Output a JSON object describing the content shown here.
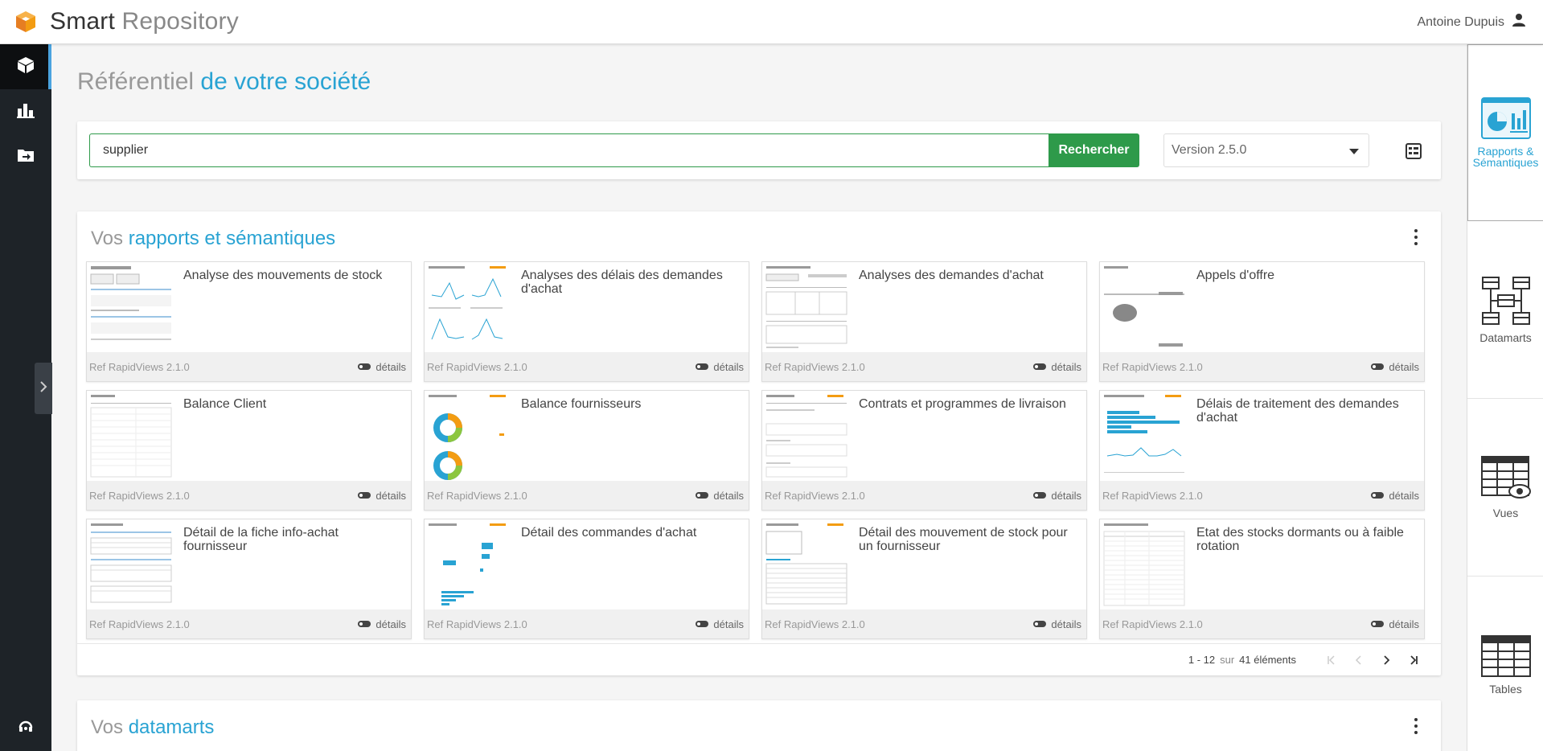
{
  "app": {
    "title_part1": "Smart",
    "title_part2": " Repository"
  },
  "user": {
    "name": "Antoine Dupuis"
  },
  "page": {
    "title_gray": "Référentiel ",
    "title_blue": "de votre société"
  },
  "search": {
    "value": "supplier",
    "button_label": "Rechercher",
    "version_selected": "Version 2.5.0"
  },
  "reports_section": {
    "title_gray": "Vos ",
    "title_blue": "rapports et sémantiques",
    "cards": [
      {
        "title": "Analyse des mouvements de stock",
        "ref": "Ref RapidViews 2.1.0",
        "details": "détails"
      },
      {
        "title": "Analyses des délais des demandes d'achat",
        "ref": "Ref RapidViews 2.1.0",
        "details": "détails"
      },
      {
        "title": "Analyses des demandes d'achat",
        "ref": "Ref RapidViews 2.1.0",
        "details": "détails"
      },
      {
        "title": "Appels d'offre",
        "ref": "Ref RapidViews 2.1.0",
        "details": "détails"
      },
      {
        "title": "Balance Client",
        "ref": "Ref RapidViews 2.1.0",
        "details": "détails"
      },
      {
        "title": "Balance fournisseurs",
        "ref": "Ref RapidViews 2.1.0",
        "details": "détails"
      },
      {
        "title": "Contrats et programmes de livraison",
        "ref": "Ref RapidViews 2.1.0",
        "details": "détails"
      },
      {
        "title": "Délais de traitement des demandes d'achat",
        "ref": "Ref RapidViews 2.1.0",
        "details": "détails"
      },
      {
        "title": "Détail de la fiche info-achat fournisseur",
        "ref": "Ref RapidViews 2.1.0",
        "details": "détails"
      },
      {
        "title": "Détail des commandes d'achat",
        "ref": "Ref RapidViews 2.1.0",
        "details": "détails"
      },
      {
        "title": "Détail des mouvement de stock pour un fournisseur",
        "ref": "Ref RapidViews 2.1.0",
        "details": "détails"
      },
      {
        "title": "Etat des stocks dormants ou à faible rotation",
        "ref": "Ref RapidViews 2.1.0",
        "details": "détails"
      }
    ],
    "pagination": {
      "range": "1 - 12",
      "sur": "sur",
      "total": "41 éléments"
    }
  },
  "datamarts_section": {
    "title_gray": "Vos ",
    "title_blue": "datamarts"
  },
  "right_panel": {
    "items": [
      {
        "label_line1": "Rapports &",
        "label_line2": "Sémantiques"
      },
      {
        "label_line1": "Datamarts",
        "label_line2": ""
      },
      {
        "label_line1": "Vues",
        "label_line2": ""
      },
      {
        "label_line1": "Tables",
        "label_line2": ""
      }
    ]
  },
  "colors": {
    "accent_blue": "#29a3d3",
    "search_green": "#2e9a4a",
    "sidebar_dark": "#1e2328",
    "logo_orange": "#f39c12"
  },
  "icons": {
    "logo": "cube-logo-icon",
    "user": "user-icon",
    "left_nav": [
      "cube-icon",
      "bar-chart-icon",
      "folder-import-icon"
    ],
    "support": "headset-icon"
  }
}
